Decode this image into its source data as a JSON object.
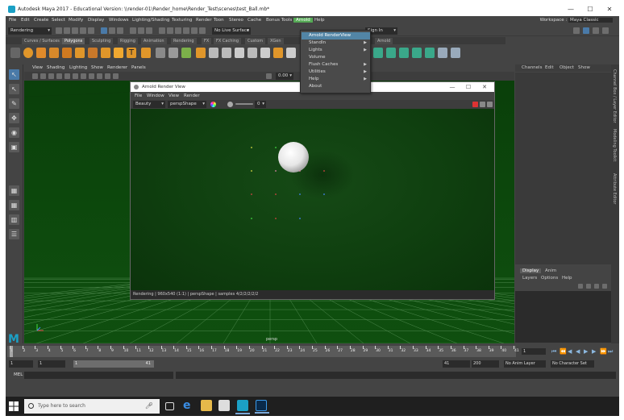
{
  "titlebar": {
    "title": "Autodesk Maya 2017 - Educational Version: \\\\render-01\\Render_home\\Render_Test\\scenes\\test_Ball.mb*",
    "min": "—",
    "max": "☐",
    "close": "✕"
  },
  "menubar": {
    "items": [
      "File",
      "Edit",
      "Create",
      "Select",
      "Modify",
      "Display",
      "Windows",
      "Lighting/Shading",
      "Texturing",
      "Render",
      "Toon",
      "Stereo",
      "Cache",
      "Bonus Tools",
      "Arnold",
      "Help"
    ],
    "active": "Arnold",
    "workspace_label": "Workspace :",
    "workspace_value": "Maya Classic"
  },
  "statusline": {
    "mode": "Rendering",
    "live_surface": "No Live Surface",
    "signin": "Sign In"
  },
  "shelf_tabs": [
    "Curves / Surfaces",
    "Polygons",
    "Sculpting",
    "Rigging",
    "Animation",
    "Rendering",
    "FX",
    "FX Caching",
    "Custom",
    "XGen"
  ],
  "shelf_active": "Polygons",
  "shelf_arnold_tab": "Arnold",
  "viewport": {
    "menu": [
      "View",
      "Shading",
      "Lighting",
      "Show",
      "Renderer",
      "Panels"
    ],
    "near_clip": "0.00",
    "camera": "persp"
  },
  "arnold_menu": {
    "items": [
      {
        "label": "Arnold RenderView",
        "submenu": false
      },
      {
        "label": "StandIn",
        "submenu": true
      },
      {
        "label": "Lights",
        "submenu": true
      },
      {
        "label": "Volume",
        "submenu": false
      },
      {
        "label": "Flush Caches",
        "submenu": true
      },
      {
        "label": "Utilities",
        "submenu": true
      },
      {
        "label": "Help",
        "submenu": true
      },
      {
        "label": "About",
        "submenu": false
      }
    ],
    "highlighted": "Arnold RenderView"
  },
  "render_view": {
    "title": "Arnold Render View",
    "menu": [
      "File",
      "Window",
      "View",
      "Render"
    ],
    "mode": "Beauty",
    "camera": "perspShape",
    "exposure": "0",
    "status": "Rendering | 960x540 (1:1) | perspShape | samples 4/2/2/2/2/2"
  },
  "channelbox": {
    "tabs": [
      "Channels",
      "Edit",
      "Object",
      "Show"
    ],
    "layer_tabs": [
      "Display",
      "Anim"
    ],
    "layer_active": "Display",
    "layer_menu": [
      "Layers",
      "Options",
      "Help"
    ]
  },
  "side_tabs": [
    "Channel Box / Layer Editor",
    "Modeling Toolkit",
    "Attribute Editor"
  ],
  "timeline": {
    "ticks": [
      "1",
      "2",
      "3",
      "4",
      "5",
      "6",
      "7",
      "8",
      "9",
      "10",
      "11",
      "12",
      "13",
      "14",
      "15",
      "16",
      "17",
      "18",
      "19",
      "20",
      "21",
      "22",
      "23",
      "24",
      "25",
      "26",
      "27",
      "28",
      "29",
      "30",
      "31",
      "32",
      "33",
      "34",
      "35",
      "36",
      "37",
      "38",
      "39",
      "40",
      "41"
    ],
    "current_frame": "1"
  },
  "range": {
    "start": "1",
    "inner_start": "1",
    "slider_start": "1",
    "slider_end": "41",
    "inner_end": "41",
    "end": "200",
    "anim_layer": "No Anim Layer",
    "char_set": "No Character Set"
  },
  "cmdline": {
    "label": "MEL"
  },
  "taskbar": {
    "search_placeholder": "Type here to search"
  }
}
